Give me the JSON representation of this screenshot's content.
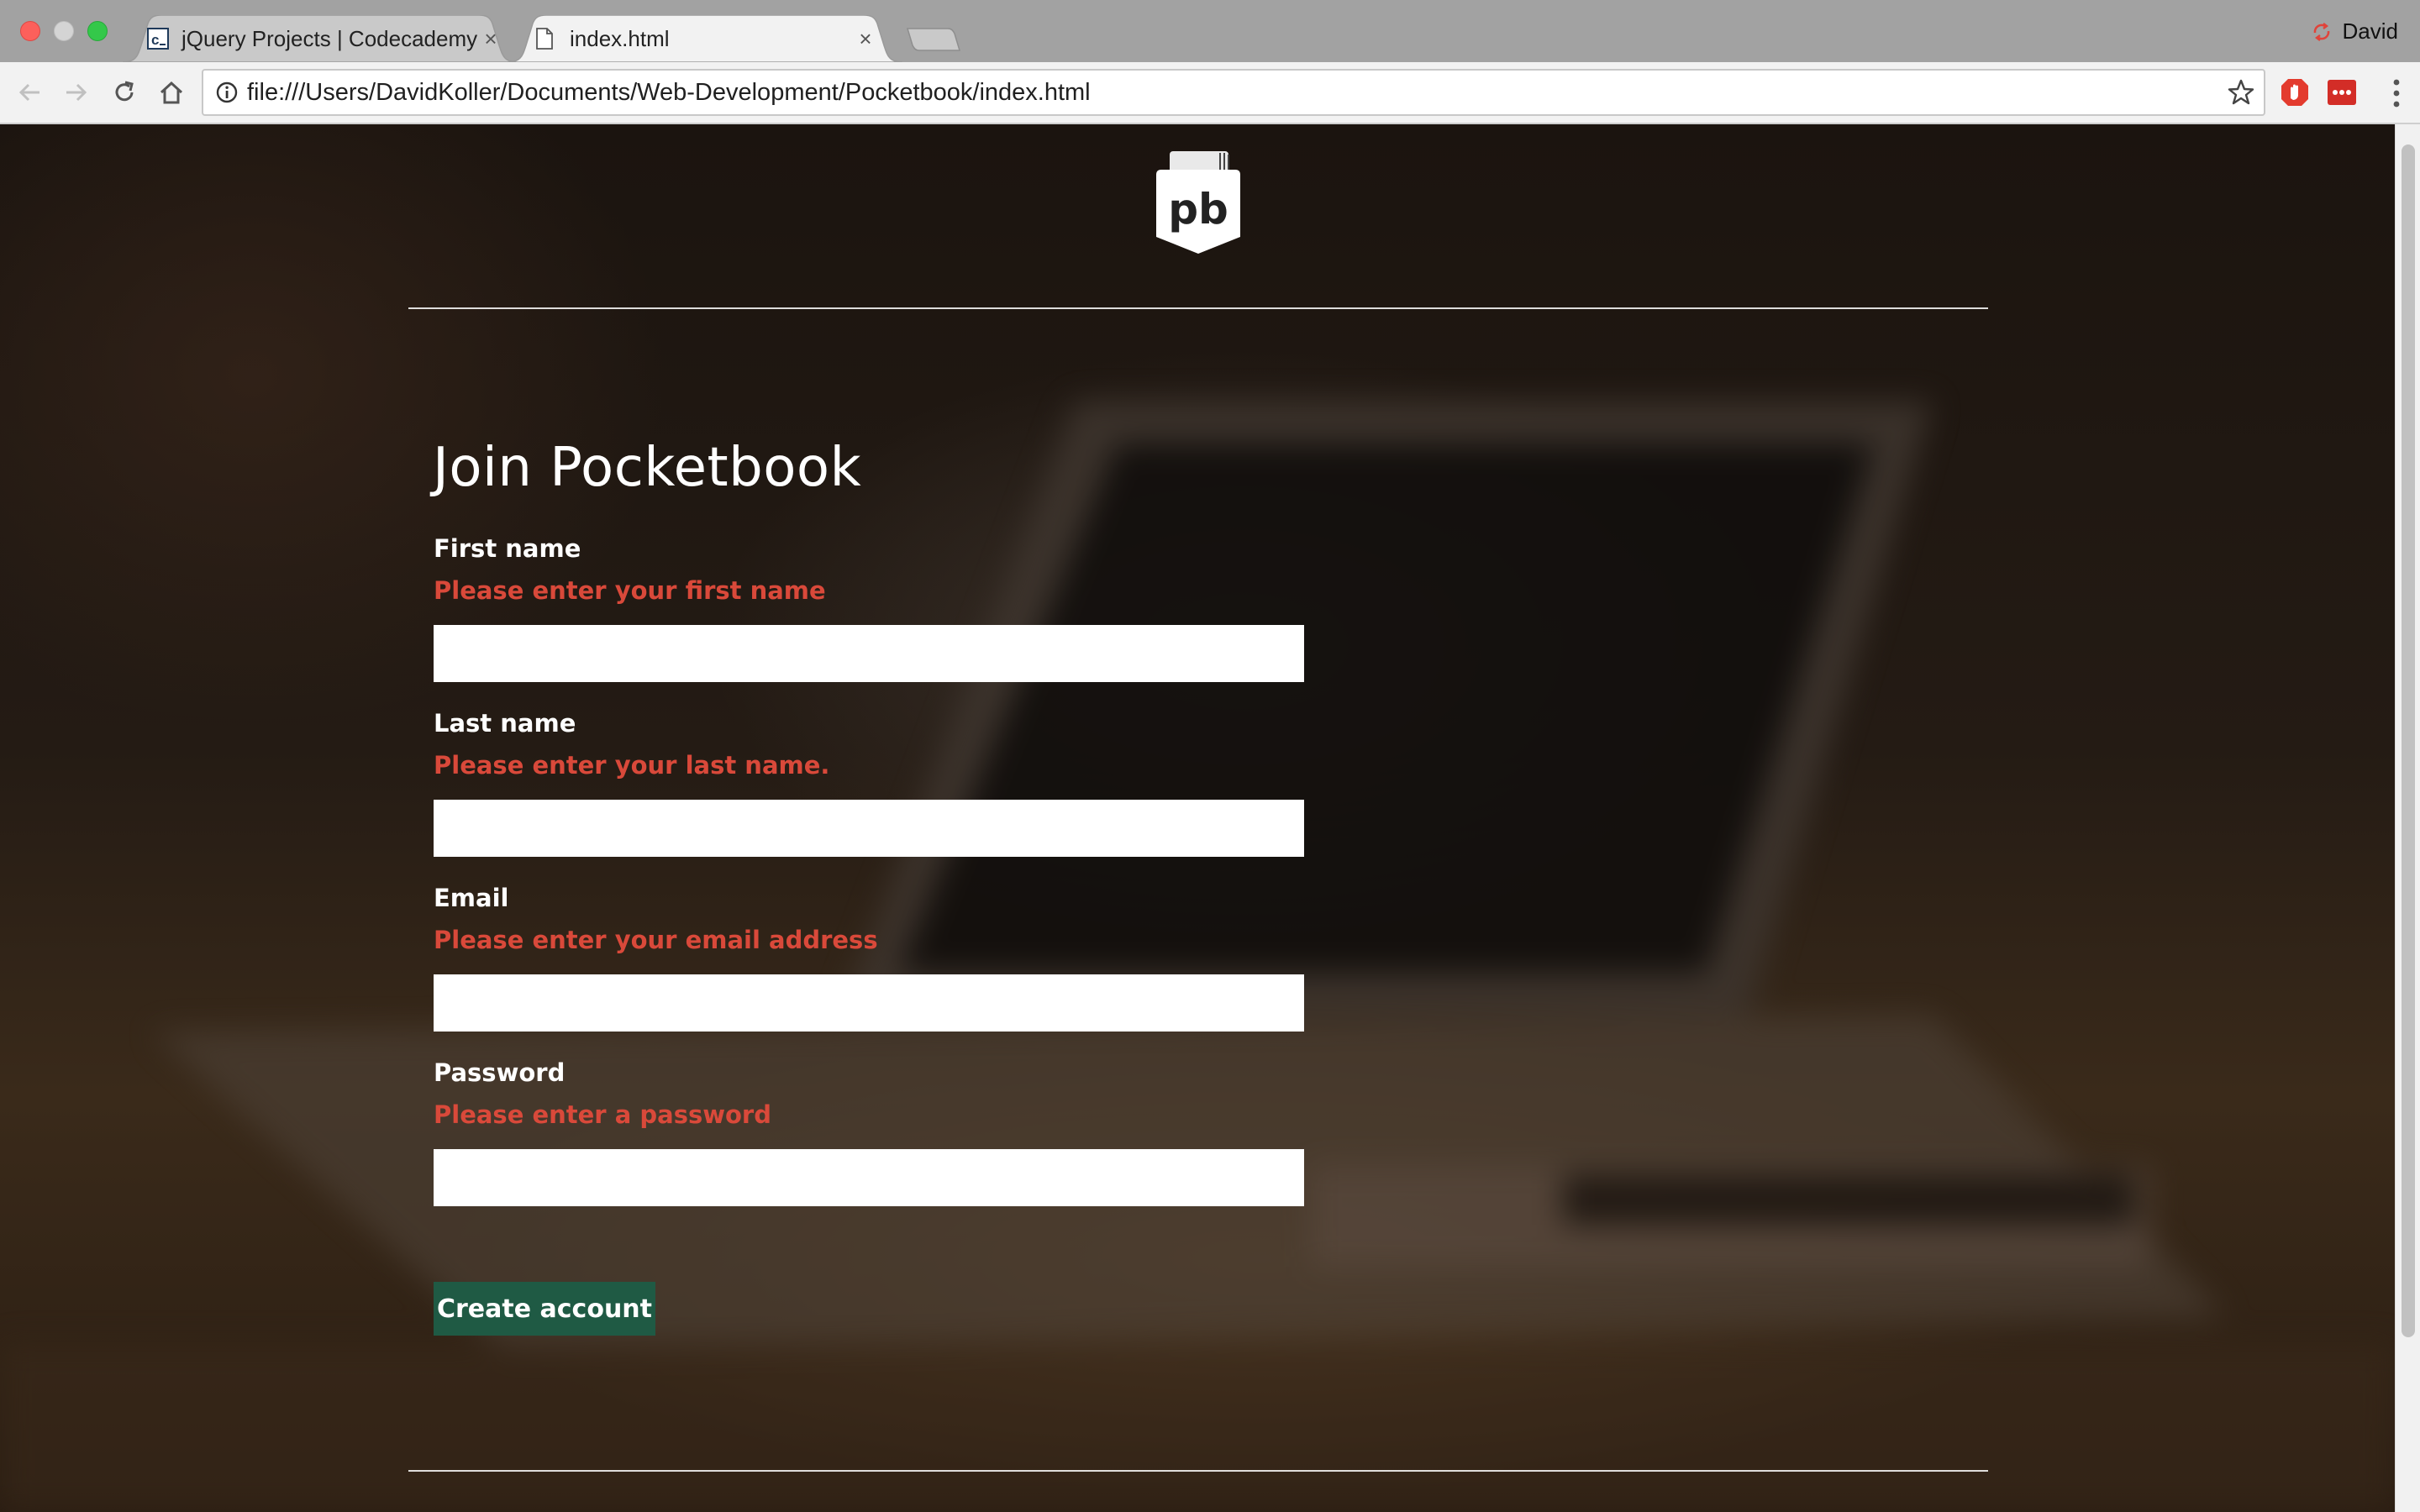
{
  "browser": {
    "tabs": [
      {
        "favicon": "codecademy-icon",
        "title": "jQuery Projects | Codecademy",
        "active": false
      },
      {
        "favicon": "file-icon",
        "title": "index.html",
        "active": true
      }
    ],
    "profile_name": "David",
    "url": "file:///Users/DavidKoller/Documents/Web-Development/Pocketbook/index.html"
  },
  "page": {
    "logo_text": "pb",
    "title": "Join Pocketbook",
    "fields": [
      {
        "label": "First name",
        "error": "Please enter your first name",
        "value": ""
      },
      {
        "label": "Last name",
        "error": "Please enter your last name.",
        "value": ""
      },
      {
        "label": "Email",
        "error": "Please enter your email address",
        "value": ""
      },
      {
        "label": "Password",
        "error": "Please enter a password",
        "value": ""
      }
    ],
    "submit_label": "Create account"
  },
  "colors": {
    "error": "#d9493a",
    "button": "#1f5a44",
    "tab_active": "#f2f2f2",
    "tab_inactive": "#c9c9c9"
  }
}
